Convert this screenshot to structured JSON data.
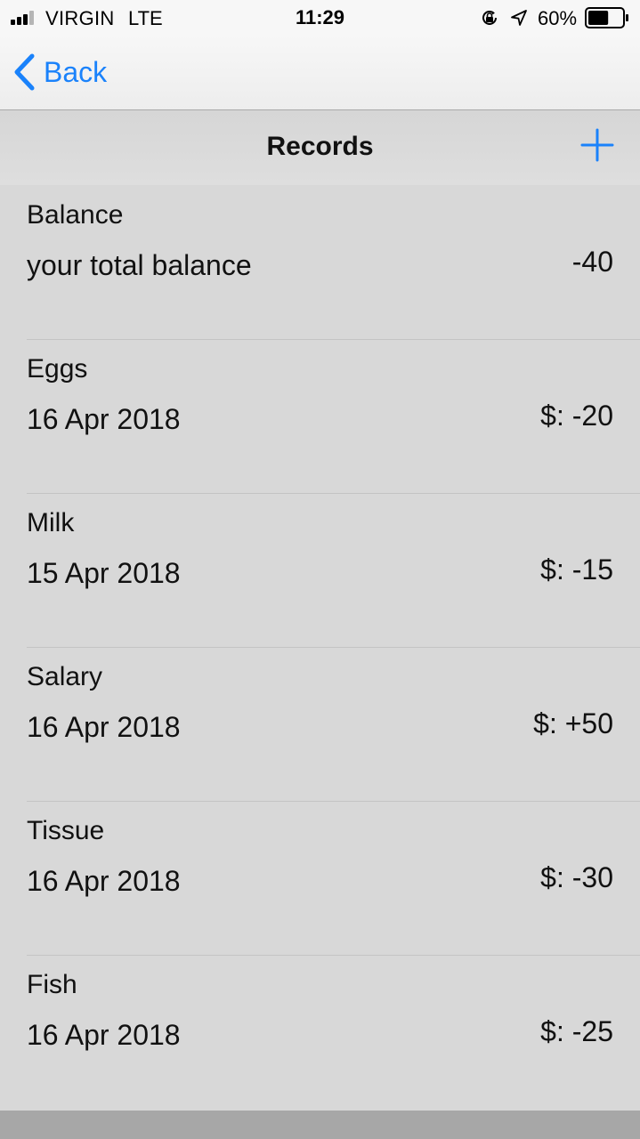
{
  "status_bar": {
    "carrier": "VIRGIN",
    "network": "LTE",
    "time": "11:29",
    "battery_percent": "60%",
    "battery_level": 0.6,
    "signal_bars_active": 3,
    "signal_bars_total": 4,
    "icons": [
      "orientation-lock-icon",
      "location-arrow-icon",
      "battery-icon"
    ]
  },
  "nav": {
    "back_label": "Back",
    "title": "Records",
    "accent_color": "#1a82fb"
  },
  "records": [
    {
      "title": "Balance",
      "subtitle": "your total balance",
      "amount": "-40"
    },
    {
      "title": "Eggs",
      "subtitle": "16 Apr 2018",
      "amount": "$: -20"
    },
    {
      "title": "Milk",
      "subtitle": "15 Apr 2018",
      "amount": "$: -15"
    },
    {
      "title": "Salary",
      "subtitle": "16 Apr 2018",
      "amount": "$: +50"
    },
    {
      "title": "Tissue",
      "subtitle": "16 Apr 2018",
      "amount": "$: -30"
    },
    {
      "title": "Fish",
      "subtitle": "16 Apr 2018",
      "amount": "$: -25"
    }
  ]
}
